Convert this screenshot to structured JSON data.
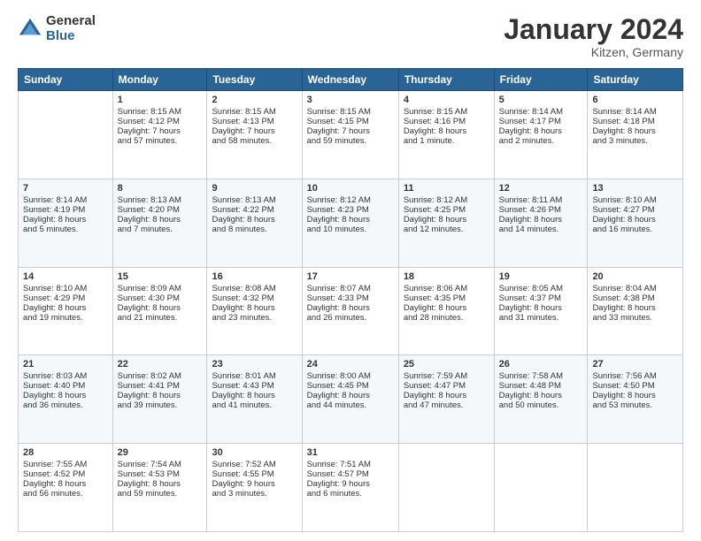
{
  "header": {
    "logo_general": "General",
    "logo_blue": "Blue",
    "month_title": "January 2024",
    "location": "Kitzen, Germany"
  },
  "weekdays": [
    "Sunday",
    "Monday",
    "Tuesday",
    "Wednesday",
    "Thursday",
    "Friday",
    "Saturday"
  ],
  "weeks": [
    [
      {
        "day": "",
        "content": ""
      },
      {
        "day": "1",
        "content": "Sunrise: 8:15 AM\nSunset: 4:12 PM\nDaylight: 7 hours\nand 57 minutes."
      },
      {
        "day": "2",
        "content": "Sunrise: 8:15 AM\nSunset: 4:13 PM\nDaylight: 7 hours\nand 58 minutes."
      },
      {
        "day": "3",
        "content": "Sunrise: 8:15 AM\nSunset: 4:15 PM\nDaylight: 7 hours\nand 59 minutes."
      },
      {
        "day": "4",
        "content": "Sunrise: 8:15 AM\nSunset: 4:16 PM\nDaylight: 8 hours\nand 1 minute."
      },
      {
        "day": "5",
        "content": "Sunrise: 8:14 AM\nSunset: 4:17 PM\nDaylight: 8 hours\nand 2 minutes."
      },
      {
        "day": "6",
        "content": "Sunrise: 8:14 AM\nSunset: 4:18 PM\nDaylight: 8 hours\nand 3 minutes."
      }
    ],
    [
      {
        "day": "7",
        "content": "Sunrise: 8:14 AM\nSunset: 4:19 PM\nDaylight: 8 hours\nand 5 minutes."
      },
      {
        "day": "8",
        "content": "Sunrise: 8:13 AM\nSunset: 4:20 PM\nDaylight: 8 hours\nand 7 minutes."
      },
      {
        "day": "9",
        "content": "Sunrise: 8:13 AM\nSunset: 4:22 PM\nDaylight: 8 hours\nand 8 minutes."
      },
      {
        "day": "10",
        "content": "Sunrise: 8:12 AM\nSunset: 4:23 PM\nDaylight: 8 hours\nand 10 minutes."
      },
      {
        "day": "11",
        "content": "Sunrise: 8:12 AM\nSunset: 4:25 PM\nDaylight: 8 hours\nand 12 minutes."
      },
      {
        "day": "12",
        "content": "Sunrise: 8:11 AM\nSunset: 4:26 PM\nDaylight: 8 hours\nand 14 minutes."
      },
      {
        "day": "13",
        "content": "Sunrise: 8:10 AM\nSunset: 4:27 PM\nDaylight: 8 hours\nand 16 minutes."
      }
    ],
    [
      {
        "day": "14",
        "content": "Sunrise: 8:10 AM\nSunset: 4:29 PM\nDaylight: 8 hours\nand 19 minutes."
      },
      {
        "day": "15",
        "content": "Sunrise: 8:09 AM\nSunset: 4:30 PM\nDaylight: 8 hours\nand 21 minutes."
      },
      {
        "day": "16",
        "content": "Sunrise: 8:08 AM\nSunset: 4:32 PM\nDaylight: 8 hours\nand 23 minutes."
      },
      {
        "day": "17",
        "content": "Sunrise: 8:07 AM\nSunset: 4:33 PM\nDaylight: 8 hours\nand 26 minutes."
      },
      {
        "day": "18",
        "content": "Sunrise: 8:06 AM\nSunset: 4:35 PM\nDaylight: 8 hours\nand 28 minutes."
      },
      {
        "day": "19",
        "content": "Sunrise: 8:05 AM\nSunset: 4:37 PM\nDaylight: 8 hours\nand 31 minutes."
      },
      {
        "day": "20",
        "content": "Sunrise: 8:04 AM\nSunset: 4:38 PM\nDaylight: 8 hours\nand 33 minutes."
      }
    ],
    [
      {
        "day": "21",
        "content": "Sunrise: 8:03 AM\nSunset: 4:40 PM\nDaylight: 8 hours\nand 36 minutes."
      },
      {
        "day": "22",
        "content": "Sunrise: 8:02 AM\nSunset: 4:41 PM\nDaylight: 8 hours\nand 39 minutes."
      },
      {
        "day": "23",
        "content": "Sunrise: 8:01 AM\nSunset: 4:43 PM\nDaylight: 8 hours\nand 41 minutes."
      },
      {
        "day": "24",
        "content": "Sunrise: 8:00 AM\nSunset: 4:45 PM\nDaylight: 8 hours\nand 44 minutes."
      },
      {
        "day": "25",
        "content": "Sunrise: 7:59 AM\nSunset: 4:47 PM\nDaylight: 8 hours\nand 47 minutes."
      },
      {
        "day": "26",
        "content": "Sunrise: 7:58 AM\nSunset: 4:48 PM\nDaylight: 8 hours\nand 50 minutes."
      },
      {
        "day": "27",
        "content": "Sunrise: 7:56 AM\nSunset: 4:50 PM\nDaylight: 8 hours\nand 53 minutes."
      }
    ],
    [
      {
        "day": "28",
        "content": "Sunrise: 7:55 AM\nSunset: 4:52 PM\nDaylight: 8 hours\nand 56 minutes."
      },
      {
        "day": "29",
        "content": "Sunrise: 7:54 AM\nSunset: 4:53 PM\nDaylight: 8 hours\nand 59 minutes."
      },
      {
        "day": "30",
        "content": "Sunrise: 7:52 AM\nSunset: 4:55 PM\nDaylight: 9 hours\nand 3 minutes."
      },
      {
        "day": "31",
        "content": "Sunrise: 7:51 AM\nSunset: 4:57 PM\nDaylight: 9 hours\nand 6 minutes."
      },
      {
        "day": "",
        "content": ""
      },
      {
        "day": "",
        "content": ""
      },
      {
        "day": "",
        "content": ""
      }
    ]
  ]
}
